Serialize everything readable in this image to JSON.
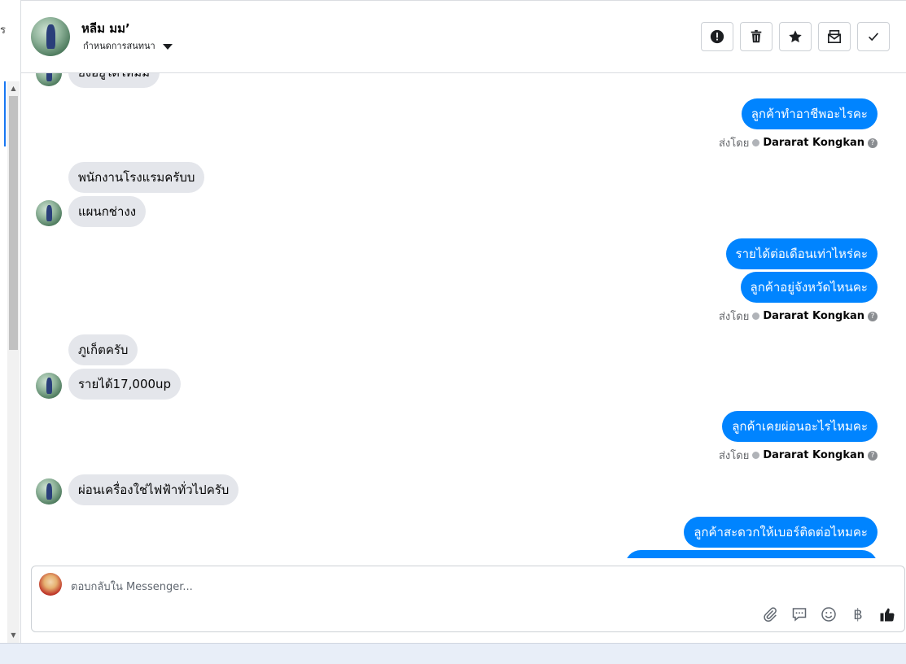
{
  "left_strip": {
    "cut_letter": "ร"
  },
  "header": {
    "contact_name": "หลีม มม’",
    "subtitle": "กำหนดการสนทนา",
    "actions": [
      {
        "name": "report-button",
        "icon": "exclamation-circle-icon"
      },
      {
        "name": "delete-button",
        "icon": "trash-icon"
      },
      {
        "name": "star-button",
        "icon": "star-icon"
      },
      {
        "name": "mark-unread-button",
        "icon": "envelope-icon"
      },
      {
        "name": "mark-done-button",
        "icon": "checkmark-icon"
      }
    ]
  },
  "messages": {
    "partial_top": "ยังอยู่ใดใหม่ม",
    "m1": "ลูกค้าทำอาชีพอะไรคะ",
    "m2": "พนักงานโรงแรมครับบ",
    "m3": "แผนกช่างง",
    "m4": "รายได้ต่อเดือนเท่าไหร่คะ",
    "m5": "ลูกค้าอยู่จังหวัดไหนคะ",
    "m6": "ภูเก็ตครับ",
    "m7": "รายได้17,000up",
    "m8": "ลูกค้าเคยผ่อนอะไรไหมคะ",
    "m9": "ผ่อนเครื่องใช่ไฟฟ้าทั่วไปครับ",
    "m10": "ลูกค้าสะดวกให้เบอร์ติดต่อไหมคะ"
  },
  "sent_by": {
    "prefix": "ส่งโดย",
    "agent": "Dararat Kongkan"
  },
  "composer": {
    "placeholder": "ตอบกลับใน Messenger...",
    "baht_symbol": "฿",
    "tools": [
      "paperclip-icon",
      "saved-replies-icon",
      "emoji-icon",
      "baht-icon",
      "thumbs-up-icon"
    ]
  },
  "colors": {
    "outgoing_bubble": "#0084ff",
    "incoming_bubble": "#e4e6eb",
    "accent": "#1877f2"
  }
}
